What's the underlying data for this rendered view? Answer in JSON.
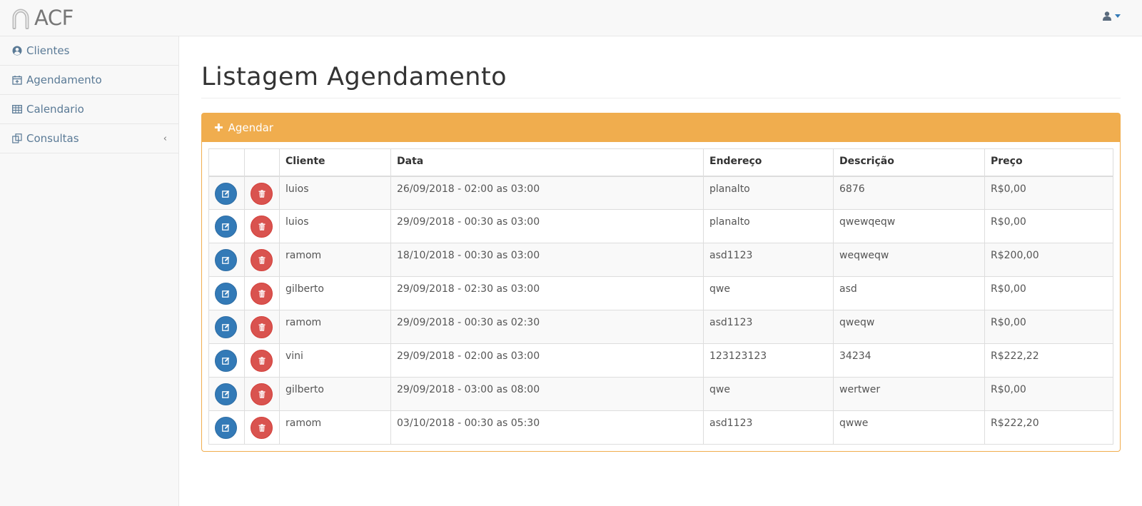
{
  "app": {
    "brand": "ACF"
  },
  "sidebar": {
    "items": [
      {
        "label": "Clientes",
        "icon": "user-circle-icon"
      },
      {
        "label": "Agendamento",
        "icon": "calendar-plus-icon"
      },
      {
        "label": "Calendario",
        "icon": "table-icon"
      },
      {
        "label": "Consultas",
        "icon": "copy-icon",
        "has_submenu": true
      }
    ]
  },
  "main": {
    "title": "Listagem Agendamento",
    "panel": {
      "add_label": "Agendar"
    },
    "table": {
      "headers": [
        "",
        "",
        "Cliente",
        "Data",
        "Endereço",
        "Descrição",
        "Preço"
      ],
      "rows": [
        {
          "cliente": "luios",
          "data": "26/09/2018 - 02:00 as 03:00",
          "endereco": "planalto",
          "descricao": "6876",
          "preco": "R$0,00"
        },
        {
          "cliente": "luios",
          "data": "29/09/2018 - 00:30 as 03:00",
          "endereco": "planalto",
          "descricao": "qwewqeqw",
          "preco": "R$0,00"
        },
        {
          "cliente": "ramom",
          "data": "18/10/2018 - 00:30 as 03:00",
          "endereco": "asd1123",
          "descricao": "weqweqw",
          "preco": "R$200,00"
        },
        {
          "cliente": "gilberto",
          "data": "29/09/2018 - 02:30 as 03:00",
          "endereco": "qwe",
          "descricao": "asd",
          "preco": "R$0,00"
        },
        {
          "cliente": "ramom",
          "data": "29/09/2018 - 00:30 as 02:30",
          "endereco": "asd1123",
          "descricao": "qweqw",
          "preco": "R$0,00"
        },
        {
          "cliente": "vini",
          "data": "29/09/2018 - 02:00 as 03:00",
          "endereco": "123123123",
          "descricao": "34234",
          "preco": "R$222,22"
        },
        {
          "cliente": "gilberto",
          "data": "29/09/2018 - 03:00 as 08:00",
          "endereco": "qwe",
          "descricao": "wertwer",
          "preco": "R$0,00"
        },
        {
          "cliente": "ramom",
          "data": "03/10/2018 - 00:30 as 05:30",
          "endereco": "asd1123",
          "descricao": "qwwe",
          "preco": "R$222,20"
        }
      ]
    }
  },
  "colors": {
    "warning": "#f0ad4e",
    "primary": "#337ab7",
    "danger": "#d9534f",
    "sidebar_text": "#5a7a96"
  }
}
